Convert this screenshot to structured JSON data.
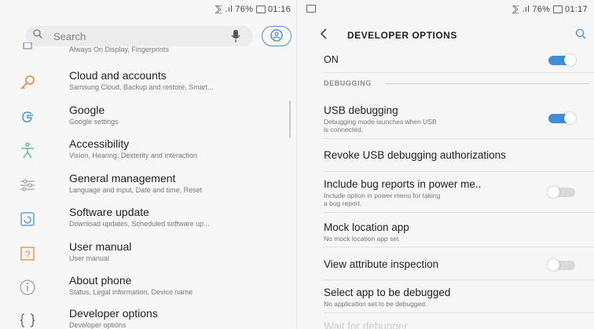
{
  "left": {
    "status": {
      "icons": "⅀ .ıl",
      "battery": "76%",
      "time": "01:16"
    },
    "search": {
      "placeholder": "Search"
    },
    "items": [
      {
        "icon": "lock-screen-icon",
        "title": "",
        "subtitle": "Always On Display, Fingerprints"
      },
      {
        "icon": "key-icon",
        "title": "Cloud and accounts",
        "subtitle": "Samsung Cloud, Backup and restore, Smart..."
      },
      {
        "icon": "google-icon",
        "title": "Google",
        "subtitle": "Google settings"
      },
      {
        "icon": "accessibility-icon",
        "title": "Accessibility",
        "subtitle": "Vision, Hearing, Dexterity and interaction"
      },
      {
        "icon": "sliders-icon",
        "title": "General management",
        "subtitle": "Language and input, Date and time, Reset"
      },
      {
        "icon": "update-icon",
        "title": "Software update",
        "subtitle": "Download updates, Scheduled software up..."
      },
      {
        "icon": "manual-icon",
        "title": "User manual",
        "subtitle": "User manual"
      },
      {
        "icon": "info-icon",
        "title": "About phone",
        "subtitle": "Status, Legal information, Device name"
      },
      {
        "icon": "braces-icon",
        "title": "Developer options",
        "subtitle": "Developer options"
      }
    ]
  },
  "right": {
    "status": {
      "icons": "⅀ .ıl",
      "battery": "76%",
      "time": "01:17"
    },
    "title": "DEVELOPER OPTIONS",
    "on_label": "ON",
    "section": "DEBUGGING",
    "items": [
      {
        "title": "USB debugging",
        "subtitle": "Debugging mode launches when USB\nis connected.",
        "toggle": "on"
      },
      {
        "title": "Revoke USB debugging authorizations",
        "subtitle": "",
        "toggle": ""
      },
      {
        "title": "Include bug reports in power me..",
        "subtitle": "Include option in power menu for taking\na bug report.",
        "toggle": "off"
      },
      {
        "title": "Mock location app",
        "subtitle": "No mock location app set",
        "toggle": ""
      },
      {
        "title": "View attribute inspection",
        "subtitle": "",
        "toggle": "off"
      },
      {
        "title": "Select app to be debugged",
        "subtitle": "No application set to be debugged.",
        "toggle": ""
      },
      {
        "title": "Wait for debugger",
        "subtitle": "",
        "toggle": ""
      }
    ],
    "colors": {
      "accent": "#3f8fd8",
      "toggle_off": "#d9d9d9"
    }
  }
}
